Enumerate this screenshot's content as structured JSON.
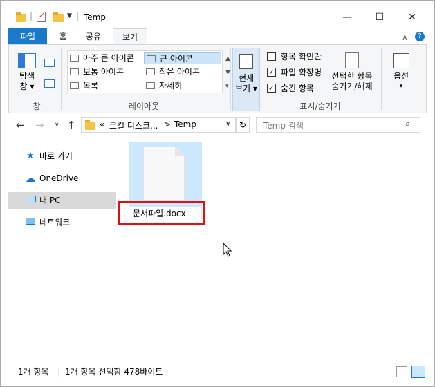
{
  "window": {
    "title": "Temp",
    "minimize": "—",
    "maximize": "☐",
    "close": "✕"
  },
  "tabs": [
    {
      "label": "파일"
    },
    {
      "label": "홈"
    },
    {
      "label": "공유"
    },
    {
      "label": "보기"
    }
  ],
  "ribbon": {
    "pane_group": {
      "navpane_label1": "탐색",
      "navpane_label2": "창",
      "group_label": "창"
    },
    "layout": {
      "items": [
        "아주 큰 아이콘",
        "큰 아이콘",
        "보통 아이콘",
        "작은 아이콘",
        "목록",
        "자세히"
      ],
      "selected": "큰 아이콘",
      "group_label": "레이아웃"
    },
    "current_view": {
      "label1": "현재",
      "label2": "보기"
    },
    "show_hide": {
      "checkbox_item": "항목 확인란",
      "checkbox_ext": "파일 확장명",
      "checkbox_hidden": "숨긴 항목",
      "hide_selected1": "선택한 항목",
      "hide_selected2": "숨기기/해제",
      "group_label": "표시/숨기기"
    },
    "options": {
      "label": "옵션"
    }
  },
  "address": {
    "prefix": "«",
    "crumb1": "로컬 디스크...",
    "sep": ">",
    "crumb2": "Temp",
    "search_placeholder": "Temp 검색"
  },
  "nav": {
    "items": [
      {
        "label": "바로 가기"
      },
      {
        "label": "OneDrive"
      },
      {
        "label": "내 PC"
      },
      {
        "label": "네트워크"
      }
    ]
  },
  "file": {
    "rename_value": "문서파일.docx"
  },
  "status": {
    "count": "1개 항목",
    "selection": "1개 항목 선택함 478바이트"
  }
}
